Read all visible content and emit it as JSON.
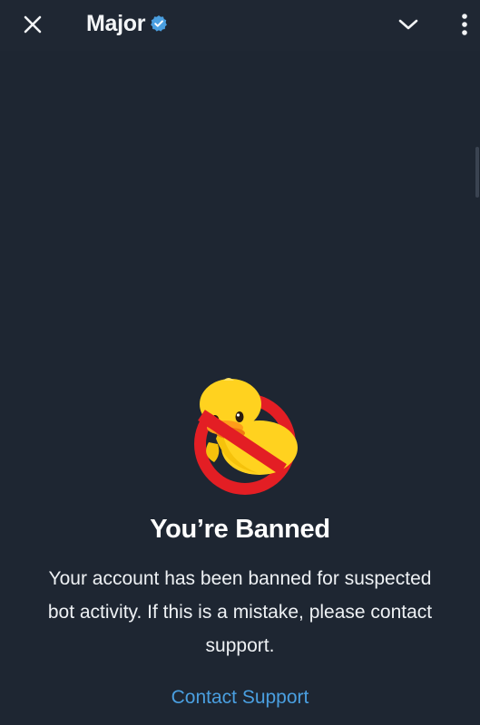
{
  "header": {
    "title": "Major",
    "verified": true,
    "icons": {
      "close": "close-icon",
      "verified": "verified-badge-icon",
      "chevron": "chevron-down-icon",
      "more": "more-vertical-icon"
    }
  },
  "main": {
    "illustration": "banned-duck-icon",
    "title": "You’re Banned",
    "message": "Your account has been banned for suspected bot activity. If this is a mistake, please contact support.",
    "contact_link": "Contact Support"
  },
  "colors": {
    "background": "#1e2632",
    "link": "#4a9fe0",
    "verified": "#4a9fe0",
    "ban_red": "#e31e24",
    "duck_yellow": "#ffd21f"
  }
}
